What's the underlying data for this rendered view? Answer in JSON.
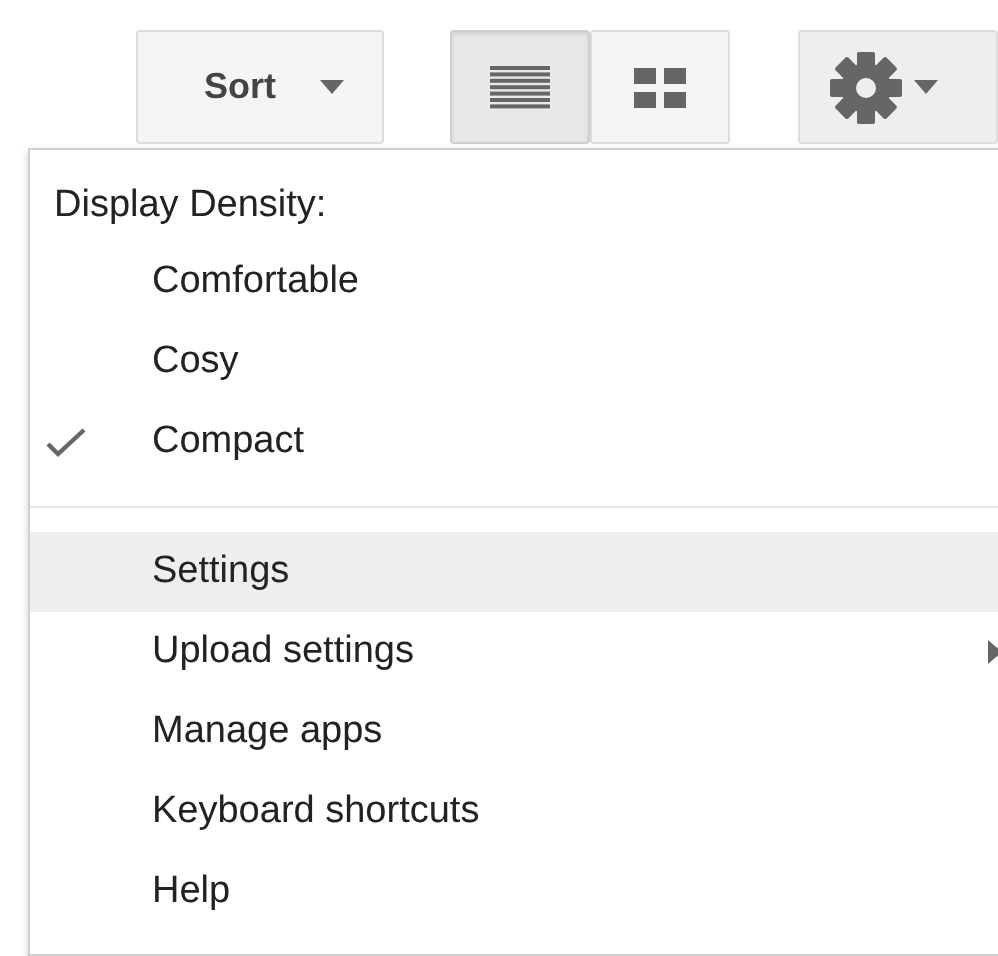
{
  "toolbar": {
    "sort_button": {
      "label": "Sort"
    },
    "view_buttons": [
      {
        "kind": "list",
        "selected": true
      },
      {
        "kind": "grid",
        "selected": false
      }
    ],
    "settings_button": {
      "has_menu": true
    }
  },
  "menu": {
    "heading": "Display Density:",
    "density_options": [
      {
        "label": "Comfortable",
        "checked": false
      },
      {
        "label": "Cosy",
        "checked": false
      },
      {
        "label": "Compact",
        "checked": true
      }
    ],
    "items": [
      {
        "label": "Settings",
        "selected": true,
        "has_submenu": false
      },
      {
        "label": "Upload settings",
        "selected": false,
        "has_submenu": true
      },
      {
        "label": "Manage apps",
        "selected": false,
        "has_submenu": false
      },
      {
        "label": "Keyboard shortcuts",
        "selected": false,
        "has_submenu": false
      },
      {
        "label": "Help",
        "selected": false,
        "has_submenu": false
      }
    ]
  }
}
